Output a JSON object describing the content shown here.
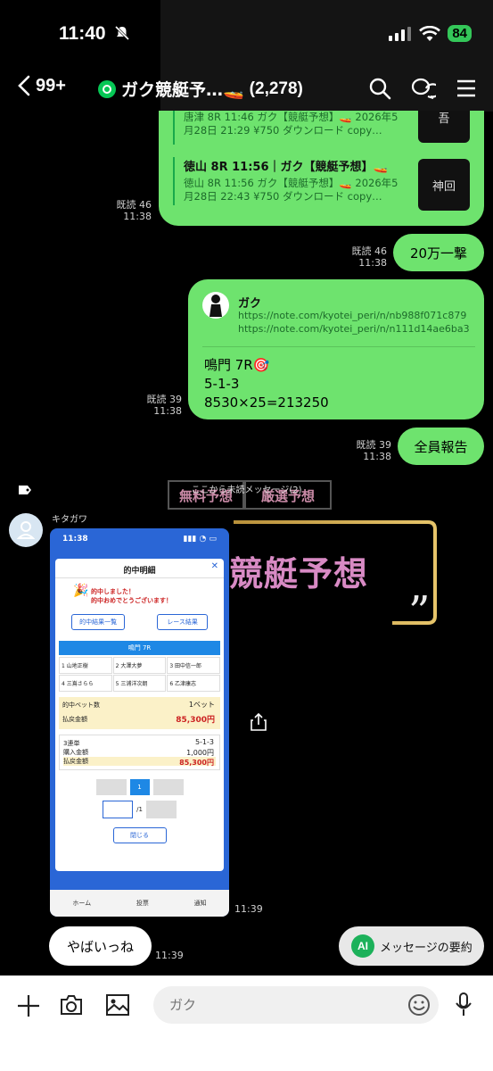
{
  "status": {
    "time": "11:40",
    "battery": "84"
  },
  "header": {
    "unread_count": "99+",
    "title": "ガク競艇予…🚤",
    "members": "(2,278)"
  },
  "messages": {
    "card1": {
      "title": "唐津 8R 11:46 ガク【競艇予想】🚤 2026年5",
      "desc": "月28日 21:29 ¥750 ダウンロード copy…",
      "thumb": "吾"
    },
    "card2": {
      "title": "徳山 8R 11:56｜ガク【競艇予想】🚤",
      "desc1": "徳山 8R 11:56 ガク【競艇予想】🚤 2026年5",
      "desc2": "月28日 22:43 ¥750 ダウンロード copy…",
      "thumb": "神回"
    },
    "meta1": {
      "read": "既読 46",
      "time": "11:38"
    },
    "pill1": {
      "text": "20万一撃",
      "read": "既読 46",
      "time": "11:38"
    },
    "link_msg": {
      "author": "ガク",
      "url1": "https://note.com/kyotei_peri/n/nb988f071c879",
      "url2": "https://note.com/kyotei_peri/n/n111d14ae6ba3",
      "line1": "鳴門 7R🎯",
      "line2": "5-1-3",
      "line3": "8530×25=213250",
      "read": "既読 39",
      "time": "11:38"
    },
    "pill2": {
      "text": "全員報告",
      "read": "既読 39",
      "time": "11:38"
    },
    "divider": "ここから未読メッセージ(2)",
    "sender": "キタガワ",
    "image": {
      "time_top": "11:38",
      "sheet_title": "的中明細",
      "close": "閉じる",
      "congrats1": "的中しました！",
      "congrats2": "的中おめでとうございます！",
      "btn_list": "的中結果一覧",
      "btn_result": "レース結果",
      "race": "鳴門 7R",
      "racers": [
        "1 山地正樹",
        "2 大澤大夢",
        "3 田中信一郎",
        "4 三嶌さらら",
        "5 三浦洋次朗",
        "6 乙津康志"
      ],
      "hit_label": "的中ベット数",
      "hit_value": "1ベット",
      "pay_label": "払戻金額",
      "pay_value": "85,300円",
      "bet_type": "3連単",
      "bet_combo": "5-1-3",
      "buy_label": "購入金額",
      "buy_value": "1,000円",
      "pay2_label": "払戻金額",
      "pay2_value": "85,300円",
      "page": "1",
      "page_total": "/1",
      "tab_home": "ホーム",
      "tab_vote": "投票",
      "tab_notice": "通知",
      "time": "11:39"
    },
    "incoming": {
      "text": "やばいっね",
      "time": "11:39"
    },
    "summary": {
      "ai": "AI",
      "label": "メッセージの要約"
    }
  },
  "background": {
    "headline": "競艇予想",
    "tab1": "無料予想",
    "tab2": "厳選予想"
  },
  "input": {
    "placeholder": "ガク"
  },
  "colors": {
    "bubble": "#6ee36e",
    "line_green": "#06c755",
    "bg": "#000000"
  }
}
